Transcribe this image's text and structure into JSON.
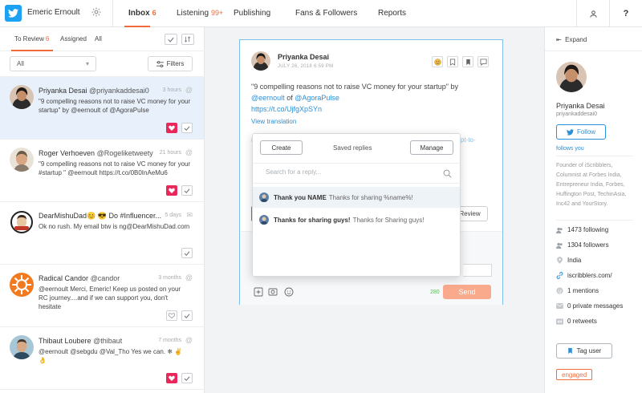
{
  "header": {
    "account_name": "Emeric Ernoult",
    "tabs": [
      {
        "label": "Inbox",
        "count": "6"
      },
      {
        "label": "Listening",
        "count": "99+"
      },
      {
        "label": "Publishing",
        "count": ""
      },
      {
        "label": "Fans & Followers",
        "count": ""
      },
      {
        "label": "Reports",
        "count": ""
      }
    ],
    "help_label": "?"
  },
  "left": {
    "subtabs": [
      {
        "label": "To Review",
        "count": "6"
      },
      {
        "label": "Assigned",
        "count": ""
      },
      {
        "label": "All",
        "count": ""
      }
    ],
    "filter_select": "All",
    "filters_label": "Filters",
    "conversations": [
      {
        "name": "Priyanka Desai",
        "handle": "@priyankaddesai0",
        "time": "3 hours",
        "text": "\"9 compelling reasons not to raise VC money for your startup\" by @eernoult of @AgoraPulse",
        "channel": "mention",
        "heart": "filled"
      },
      {
        "name": "Roger Verhoeven",
        "handle": "@Rogeliketweety",
        "time": "21 hours",
        "text": "\"9 compelling reasons not to raise VC money for your #startup \" @eernoult https://t.co/0B0InAeMu6",
        "channel": "mention",
        "heart": "filled"
      },
      {
        "name": "DearMishuDad😊 😎 Do #Influencer...",
        "handle": "",
        "time": "5 days",
        "text": "Ok no rush. My email btw is ng@DearMishuDad.com",
        "channel": "dm",
        "heart": "none"
      },
      {
        "name": "Radical Candor",
        "handle": "@candor",
        "time": "3 months",
        "text": "@eernoult Merci, Emeric! Keep us posted on your RC journey....and if we can support you, don't hesitate",
        "channel": "mention",
        "heart": "outline"
      },
      {
        "name": "Thibaut Loubere",
        "handle": "@thibaut",
        "time": "7 months",
        "text": "@eernoult @sebgdu @Val_Tho Yes we can. ❄ ✌ 👌",
        "channel": "mention",
        "heart": "filled"
      }
    ]
  },
  "message": {
    "author": "Priyanka Desai",
    "date": "JULY 26, 2018 6:59 PM",
    "text_prefix": "\"9 compelling reasons not to raise VC money for your startup\" by",
    "mention1": "@eernoult",
    "text_of": "of",
    "mention2": "@AgoraPulse",
    "link": "https://t.co/UjfgXpSYn",
    "view_translation": "View translation",
    "faded_link": "pt-to-",
    "faded_link2": "n",
    "review_label": "Review",
    "char_count": "280",
    "send_label": "Send"
  },
  "saved_replies": {
    "create_label": "Create",
    "title": "Saved replies",
    "manage_label": "Manage",
    "search_placeholder": "Search for a reply...",
    "items": [
      {
        "title": "Thank you NAME",
        "body": "Thanks for sharing %name%!"
      },
      {
        "title": "Thanks for sharing guys!",
        "body": "Thanks for Sharing guys!"
      }
    ]
  },
  "profile": {
    "expand_label": "Expand",
    "name": "Priyanka Desai",
    "handle": "priyankaddesai0",
    "follow_label": "Follow",
    "follows_you": "follows you",
    "bio": "Founder of iScribblers, Columnist at Forbes India, Entrepreneur India, Forbes, Huffington Post, TechinAsia, Inc42 and YourStory.",
    "stats": [
      {
        "icon": "users-icon",
        "text": "1473 following"
      },
      {
        "icon": "users-icon",
        "text": "1304 followers"
      },
      {
        "icon": "location-icon",
        "text": "India"
      },
      {
        "icon": "link-icon",
        "text": "iscribblers.com/"
      },
      {
        "icon": "mention-icon",
        "text": "1 mentions"
      },
      {
        "icon": "envelope-icon",
        "text": "0 private messages"
      },
      {
        "icon": "retweet-icon",
        "text": "0 retweets"
      }
    ],
    "tag_user_label": "Tag user",
    "label_badge": "engaged"
  },
  "colors": {
    "accent": "#f26b3a",
    "twitter_blue": "#1da1f2",
    "link_blue": "#2a8fd6",
    "heart_red": "#e8275b"
  }
}
